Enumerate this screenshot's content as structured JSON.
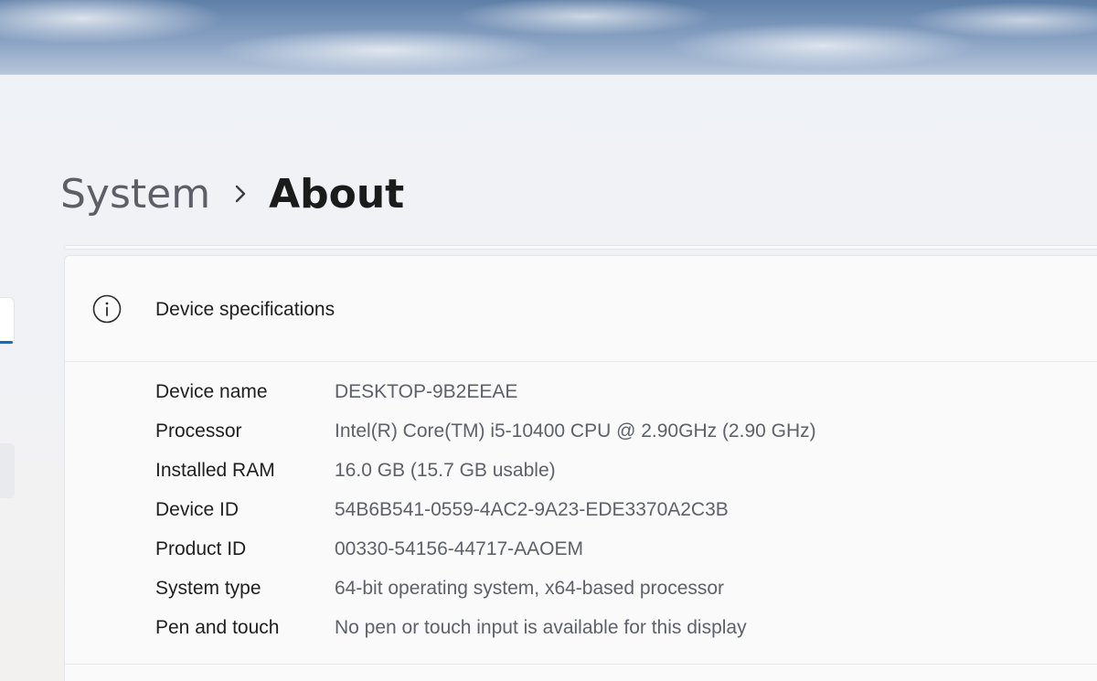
{
  "breadcrumb": {
    "parent": "System",
    "separator_icon": "chevron-right-icon",
    "current": "About"
  },
  "device_specifications": {
    "icon": "info-icon",
    "title": "Device specifications",
    "rows": [
      {
        "label": "Device name",
        "value": "DESKTOP-9B2EEAE"
      },
      {
        "label": "Processor",
        "value": "Intel(R) Core(TM) i5-10400 CPU @ 2.90GHz (2.90 GHz)"
      },
      {
        "label": "Installed RAM",
        "value": "16.0 GB (15.7 GB usable)"
      },
      {
        "label": "Device ID",
        "value": "54B6B541-0559-4AC2-9A23-EDE3370A2C3B"
      },
      {
        "label": "Product ID",
        "value": "00330-54156-44717-AAOEM"
      },
      {
        "label": "System type",
        "value": "64-bit operating system, x64-based processor"
      },
      {
        "label": "Pen and touch",
        "value": "No pen or touch input is available for this display"
      }
    ]
  },
  "colors": {
    "accent": "#0a6fc2",
    "title_text": "#1b1b1b",
    "secondary_text": "#5e6167"
  }
}
